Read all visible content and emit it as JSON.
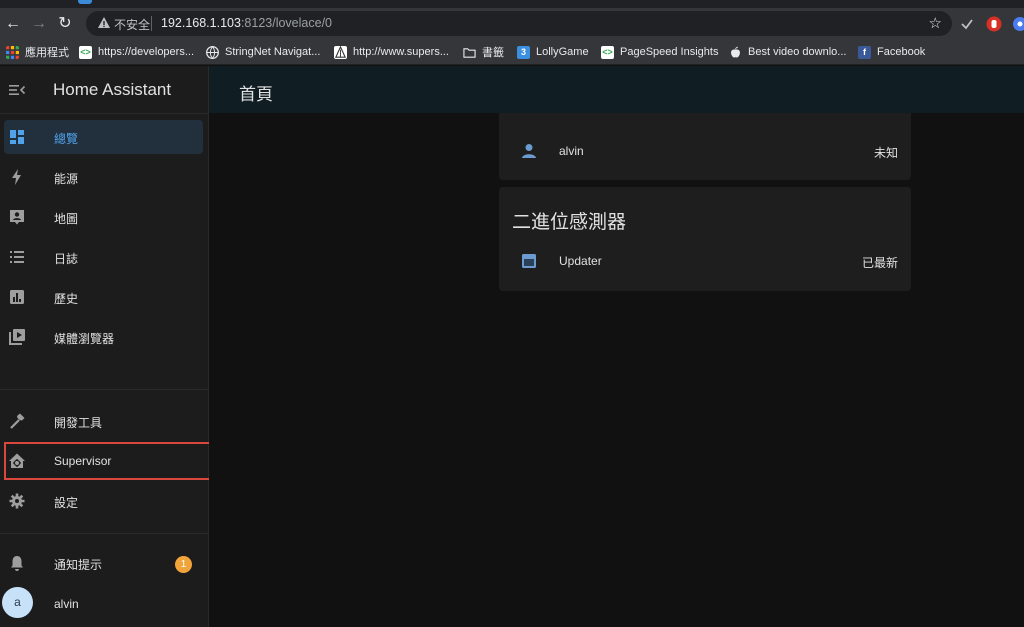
{
  "browser": {
    "insecure_label": "不安全",
    "url_host": "192.168.1.103",
    "url_rest": ":8123/lovelace/0",
    "bookmarks": [
      {
        "label": "應用程式",
        "icon": "apps-grid-icon"
      },
      {
        "label": "https://developers...",
        "icon": "code-favicon-icon"
      },
      {
        "label": "StringNet Navigat...",
        "icon": "globe-icon"
      },
      {
        "label": "http://www.supers...",
        "icon": "tree-favicon-icon"
      },
      {
        "label": "書籤",
        "icon": "folder-icon"
      },
      {
        "label": "LollyGame",
        "icon": "lollygame-favicon-icon"
      },
      {
        "label": "PageSpeed Insights",
        "icon": "code-favicon-icon"
      },
      {
        "label": "Best video downlo...",
        "icon": "apple-icon"
      },
      {
        "label": "Facebook",
        "icon": "facebook-icon"
      }
    ]
  },
  "sidebar": {
    "title": "Home Assistant",
    "items": [
      {
        "label": "總覽",
        "icon": "dashboard-icon",
        "active": true
      },
      {
        "label": "能源",
        "icon": "lightning-icon"
      },
      {
        "label": "地圖",
        "icon": "map-account-icon"
      },
      {
        "label": "日誌",
        "icon": "list-icon"
      },
      {
        "label": "歷史",
        "icon": "chart-box-icon"
      },
      {
        "label": "媒體瀏覽器",
        "icon": "play-box-multiple-icon"
      },
      {
        "label": "開發工具",
        "icon": "hammer-icon"
      },
      {
        "label": "Supervisor",
        "icon": "home-assistant-supervisor-icon"
      },
      {
        "label": "設定",
        "icon": "gear-icon"
      }
    ],
    "notifications": {
      "label": "通知提示",
      "count": "1"
    },
    "user": {
      "name": "alvin",
      "initial": "a"
    }
  },
  "header": {
    "title": "首頁"
  },
  "cards": {
    "person": {
      "name": "alvin",
      "state": "未知"
    },
    "binary_sensor": {
      "title": "二進位感測器",
      "entity": {
        "name": "Updater",
        "state": "已最新"
      }
    }
  },
  "colors": {
    "accent": "#4fa3ea",
    "active_bg": "#22303d",
    "badge": "#f1a43a",
    "highlight_border": "#d9483b"
  }
}
